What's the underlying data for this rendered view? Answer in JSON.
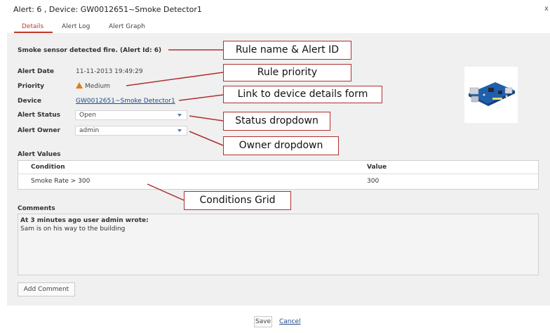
{
  "window": {
    "title": "Alert: 6 , Device: GW0012651~Smoke Detector1",
    "close": "x"
  },
  "tabs": [
    {
      "label": "Details",
      "active": true
    },
    {
      "label": "Alert Log",
      "active": false
    },
    {
      "label": "Alert Graph",
      "active": false
    }
  ],
  "rule_heading": "Smoke sensor detected fire. (Alert Id: 6)",
  "fields": {
    "alert_date_label": "Alert Date",
    "alert_date_value": "11-11-2013 19:49:29",
    "priority_label": "Priority",
    "priority_value": "Medium",
    "device_label": "Device",
    "device_value": "GW0012651~Smoke Detector1",
    "status_label": "Alert Status",
    "status_value": "Open",
    "owner_label": "Alert Owner",
    "owner_value": "admin"
  },
  "alert_values": {
    "title": "Alert Values",
    "columns": [
      "Condition",
      "Value"
    ],
    "rows": [
      {
        "condition": "Smoke Rate > 300",
        "value": "300"
      }
    ]
  },
  "comments": {
    "title": "Comments",
    "author_line": "At 3 minutes ago user admin wrote:",
    "text": "Sam is on his way to the building"
  },
  "buttons": {
    "add_comment": "Add Comment",
    "save": "Save",
    "cancel": "Cancel"
  },
  "callouts": {
    "rule_name": "Rule name & Alert ID",
    "rule_priority": "Rule priority",
    "device_link": "Link to device details form",
    "status_dropdown": "Status dropdown",
    "owner_dropdown": "Owner dropdown",
    "conditions_grid": "Conditions Grid"
  },
  "colors": {
    "accent": "#c0392b",
    "callout_border": "#b03030",
    "priority": "#e07c14",
    "link": "#1e4a8c"
  }
}
